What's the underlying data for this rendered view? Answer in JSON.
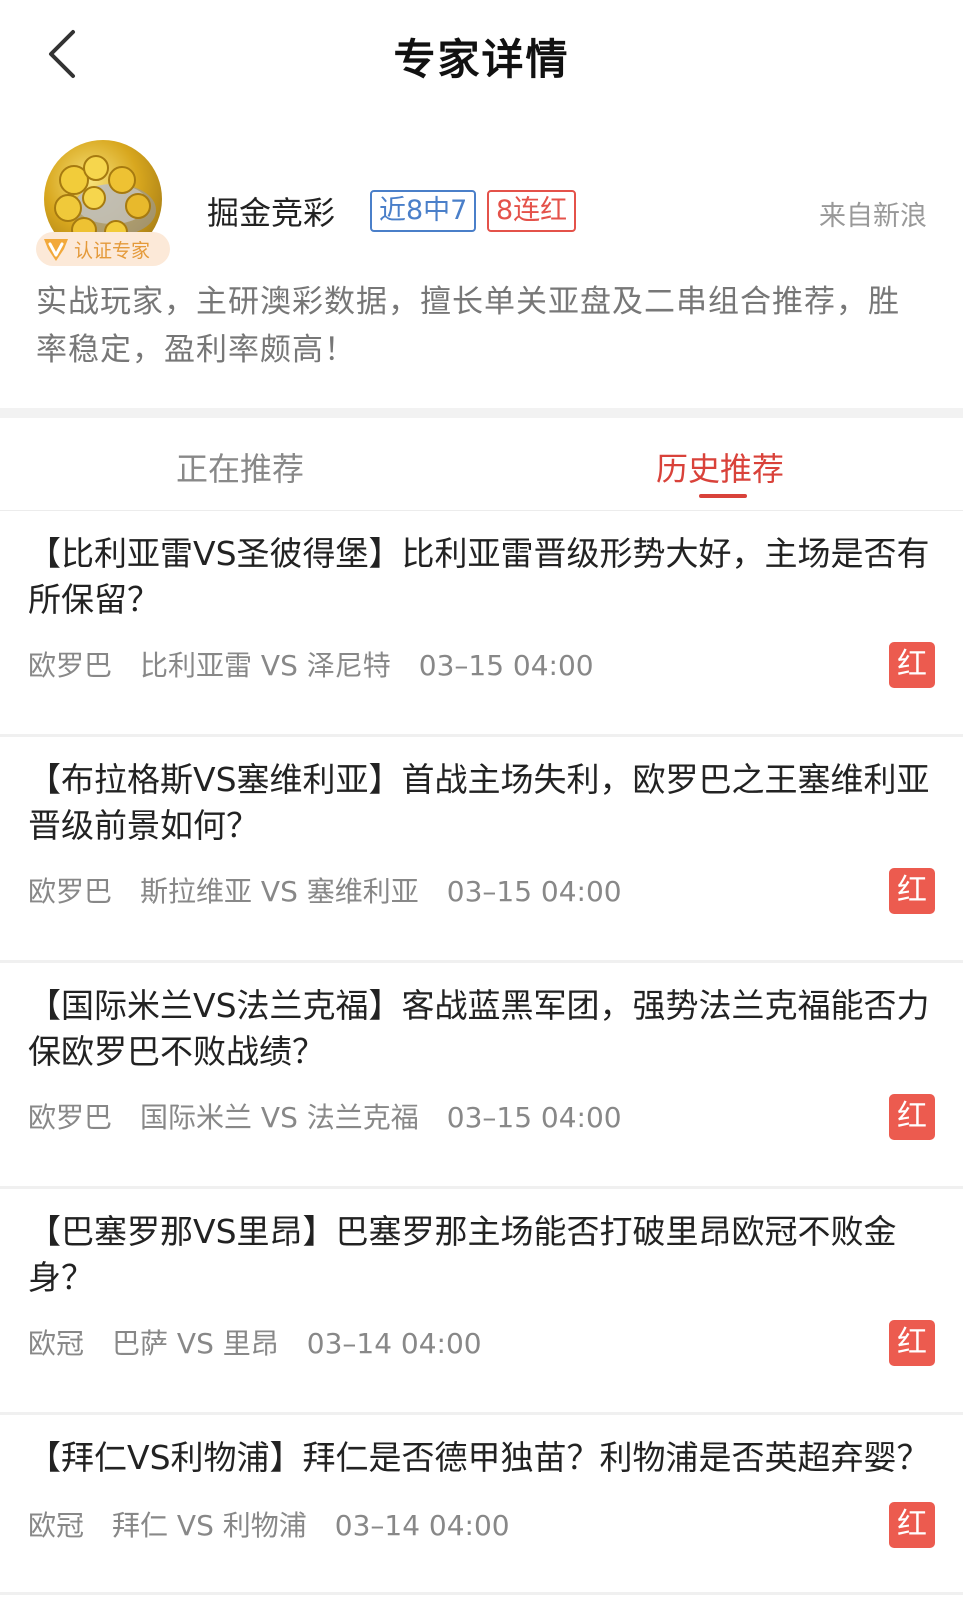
{
  "header": {
    "title": "专家详情"
  },
  "expert": {
    "name": "掘金竞彩",
    "verified_label": "认证专家",
    "tag_record": "近8中7",
    "tag_streak": "8连红",
    "source": "来自新浪",
    "bio": "实战玩家，主研澳彩数据，擅长单关亚盘及二串组合推荐，胜率稳定，盈利率颇高！"
  },
  "colors": {
    "accent_red": "#d9423a",
    "badge_red": "#ec5b4f",
    "tag_blue": "#4a7fc9",
    "verified_orange": "#e49a3a"
  },
  "tabs": [
    {
      "label": "正在推荐",
      "active": false
    },
    {
      "label": "历史推荐",
      "active": true
    }
  ],
  "recommendations": [
    {
      "title": "【比利亚雷VS圣彼得堡】比利亚雷晋级形势大好，主场是否有所保留？",
      "league": "欧罗巴",
      "match": "比利亚雷 VS 泽尼特",
      "time": "03–15 04:00",
      "result": "红"
    },
    {
      "title": "【布拉格斯VS塞维利亚】首战主场失利，欧罗巴之王塞维利亚晋级前景如何？",
      "league": "欧罗巴",
      "match": "斯拉维亚 VS 塞维利亚",
      "time": "03–15 04:00",
      "result": "红"
    },
    {
      "title": "【国际米兰VS法兰克福】客战蓝黑军团，强势法兰克福能否力保欧罗巴不败战绩？",
      "league": "欧罗巴",
      "match": "国际米兰 VS 法兰克福",
      "time": "03–15 04:00",
      "result": "红"
    },
    {
      "title": "【巴塞罗那VS里昂】巴塞罗那主场能否打破里昂欧冠不败金身？",
      "league": "欧冠",
      "match": "巴萨 VS 里昂",
      "time": "03–14 04:00",
      "result": "红"
    },
    {
      "title": "【拜仁VS利物浦】拜仁是否德甲独苗？利物浦是否英超弃婴？",
      "league": "欧冠",
      "match": "拜仁 VS 利物浦",
      "time": "03–14 04:00",
      "result": "红"
    }
  ]
}
